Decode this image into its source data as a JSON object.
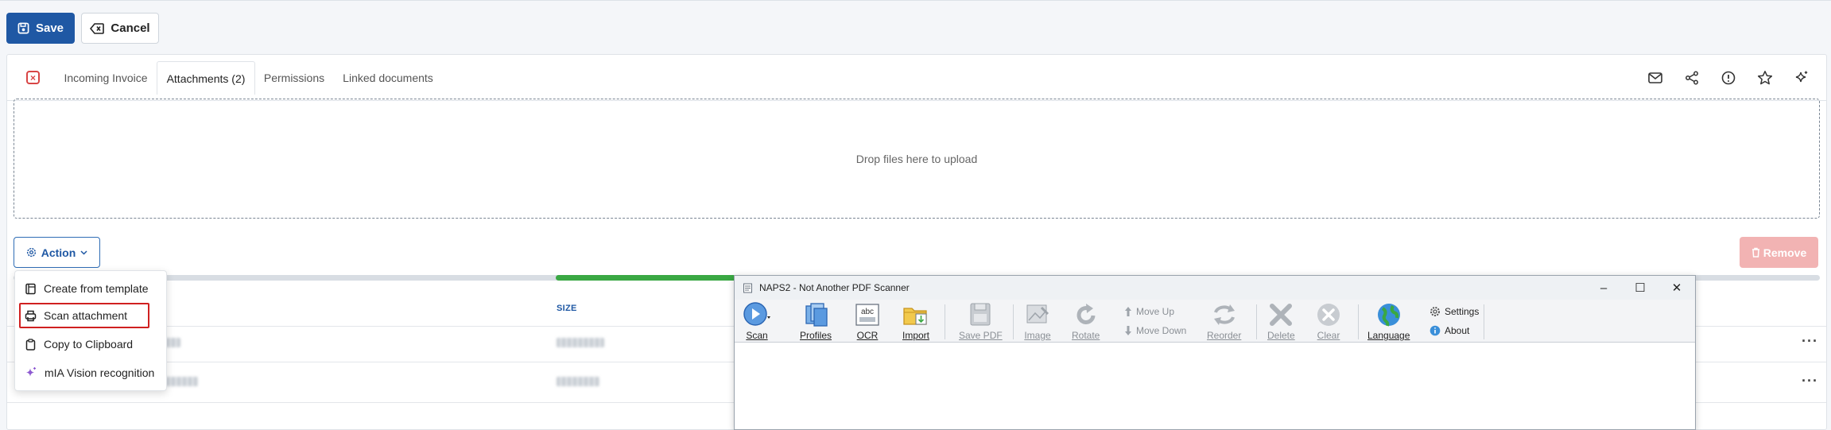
{
  "toolbar": {
    "save_label": "Save",
    "cancel_label": "Cancel"
  },
  "tabs": [
    {
      "label": "Incoming Invoice",
      "active": false
    },
    {
      "label": "Attachments (2)",
      "active": true
    },
    {
      "label": "Permissions",
      "active": false
    },
    {
      "label": "Linked documents",
      "active": false
    }
  ],
  "tab_icons": [
    "mail-icon",
    "share-icon",
    "info-icon",
    "star-icon",
    "sparkle-icon"
  ],
  "dropzone": {
    "text": "Drop files here to upload"
  },
  "action": {
    "label": "Action"
  },
  "remove": {
    "label": "Remove"
  },
  "progress": {
    "fill_start_fraction": 0.3,
    "fill_end_fraction": 0.62
  },
  "table": {
    "size_header": "SIZE"
  },
  "menu": {
    "items": [
      {
        "label": "Create from template",
        "icon": "template-icon"
      },
      {
        "label": "Scan attachment",
        "icon": "printer-icon",
        "highlighted": true
      },
      {
        "label": "Copy to Clipboard",
        "icon": "clipboard-icon"
      },
      {
        "label": "mIA Vision recognition",
        "icon": "sparkle-icon"
      }
    ]
  },
  "naps": {
    "title": "NAPS2 - Not Another PDF Scanner",
    "buttons": {
      "scan": "Scan",
      "profiles": "Profiles",
      "ocr": "OCR",
      "import": "Import",
      "save_pdf": "Save PDF",
      "image": "Image",
      "rotate": "Rotate",
      "move_up": "Move Up",
      "move_down": "Move Down",
      "reorder": "Reorder",
      "delete": "Delete",
      "clear": "Clear",
      "language": "Language",
      "settings": "Settings",
      "about": "About"
    },
    "ocr_icon_text": "abc"
  },
  "colors": {
    "primary": "#1f58a4",
    "danger": "#d02020",
    "success": "#3aa843",
    "remove_disabled": "#f2b3b3"
  }
}
